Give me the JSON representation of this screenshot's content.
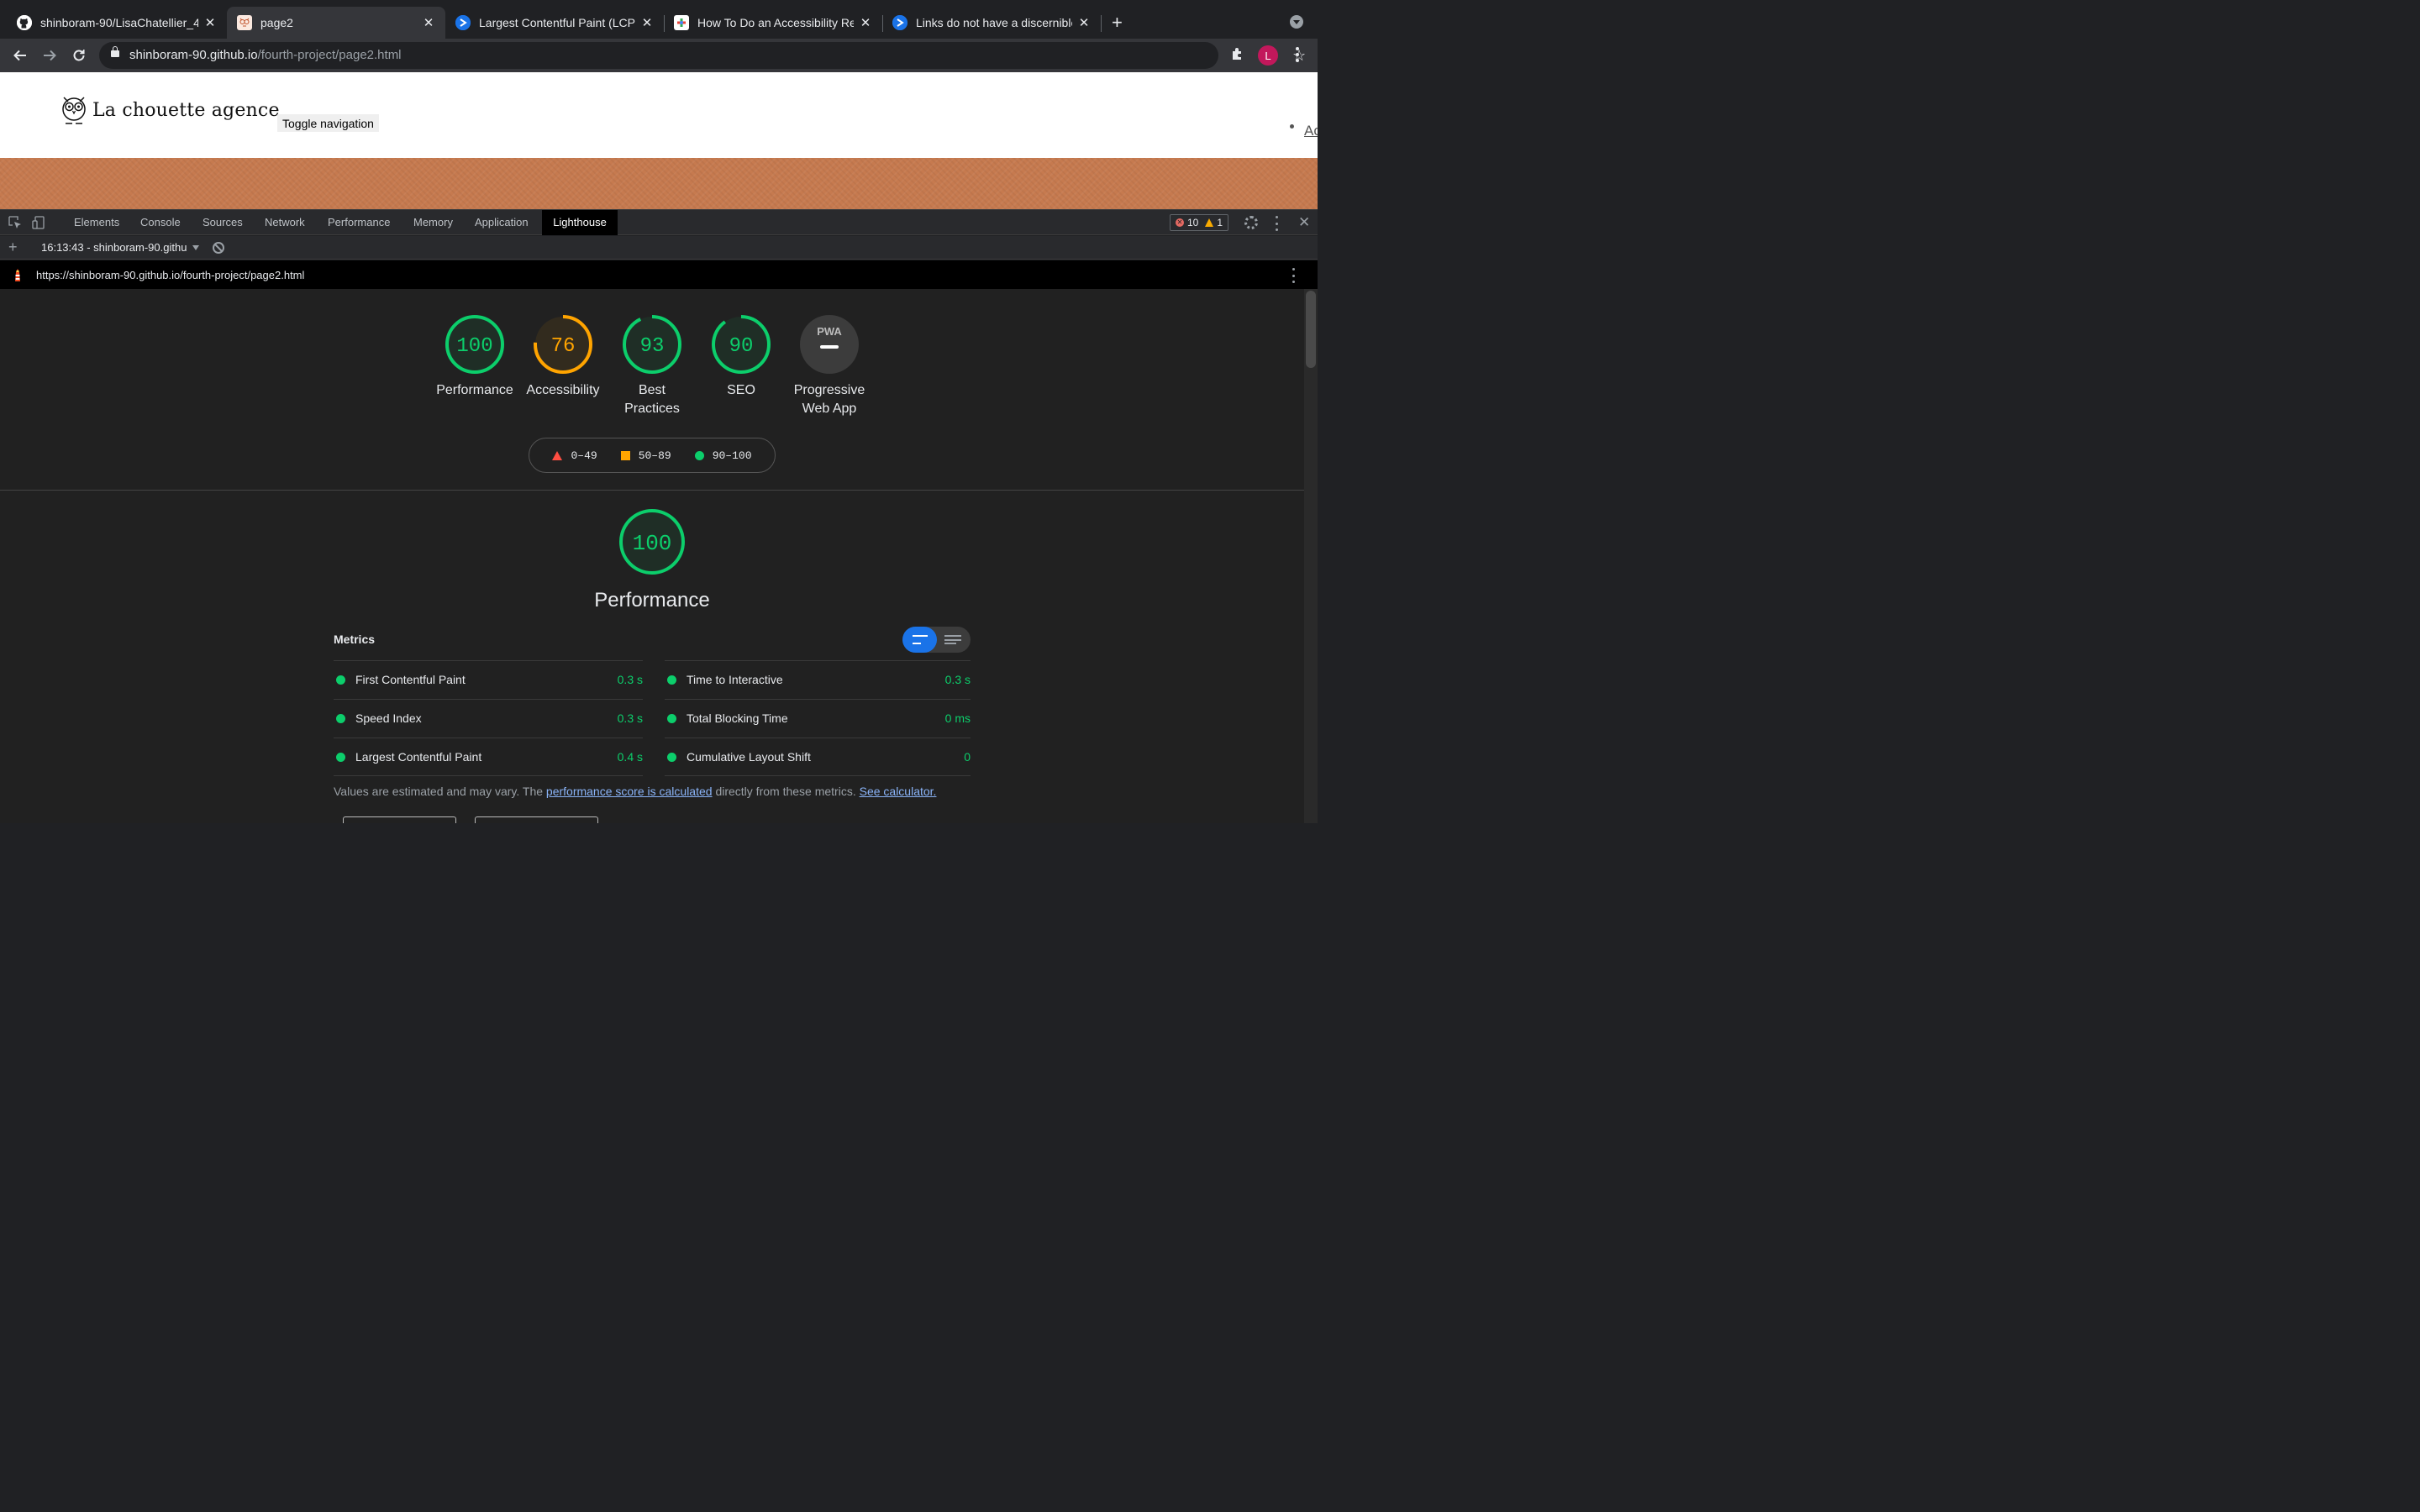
{
  "browser": {
    "tabs": [
      {
        "title": "shinboram-90/LisaChatellier_4",
        "favicon": "github-icon"
      },
      {
        "title": "page2",
        "favicon": "owl-icon"
      },
      {
        "title": "Largest Contentful Paint (LCP)",
        "favicon": "webdev-icon"
      },
      {
        "title": "How To Do an Accessibility Rev",
        "favicon": "google-icon"
      },
      {
        "title": "Links do not have a discernible",
        "favicon": "webdev-icon"
      }
    ],
    "active_tab": 1,
    "url_host": "shinboram-90.github.io",
    "url_path": "/fourth-project/page2.html",
    "profile_initial": "L"
  },
  "page": {
    "logo_text": "La chouette agence",
    "toggle_label": "Toggle navigation",
    "nav_link": "Ac"
  },
  "devtools": {
    "tabs": [
      "Elements",
      "Console",
      "Sources",
      "Network",
      "Performance",
      "Memory",
      "Application",
      "Lighthouse"
    ],
    "active_tab": "Lighthouse",
    "error_count": "10",
    "warning_count": "1",
    "report_selector": "16:13:43 - shinboram-90.githu",
    "report_url": "https://shinboram-90.github.io/fourth-project/page2.html"
  },
  "lighthouse": {
    "categories": [
      {
        "label": "Performance",
        "score": 100,
        "color": "#0cce6b"
      },
      {
        "label": "Accessibility",
        "score": 76,
        "color": "#ffa400"
      },
      {
        "label": "Best Practices",
        "score": 93,
        "color": "#0cce6b"
      },
      {
        "label": "SEO",
        "score": 90,
        "color": "#0cce6b"
      },
      {
        "label": "Progressive Web App",
        "score": null,
        "badge": "PWA"
      }
    ],
    "legend": [
      {
        "range": "0–49",
        "shape": "triangle",
        "color": "#ff4e42"
      },
      {
        "range": "50–89",
        "shape": "square",
        "color": "#ffa400"
      },
      {
        "range": "90–100",
        "shape": "circle",
        "color": "#0cce6b"
      }
    ],
    "performance": {
      "score": 100,
      "title": "Performance",
      "metrics_heading": "Metrics",
      "metrics_left": [
        {
          "name": "First Contentful Paint",
          "value": "0.3 s"
        },
        {
          "name": "Speed Index",
          "value": "0.3 s"
        },
        {
          "name": "Largest Contentful Paint",
          "value": "0.4 s"
        }
      ],
      "metrics_right": [
        {
          "name": "Time to Interactive",
          "value": "0.3 s"
        },
        {
          "name": "Total Blocking Time",
          "value": "0 ms"
        },
        {
          "name": "Cumulative Layout Shift",
          "value": "0"
        }
      ],
      "note_prefix": "Values are estimated and may vary. The ",
      "note_link1": "performance score is calculated",
      "note_middle": " directly from these metrics. ",
      "note_link2": "See calculator."
    }
  }
}
